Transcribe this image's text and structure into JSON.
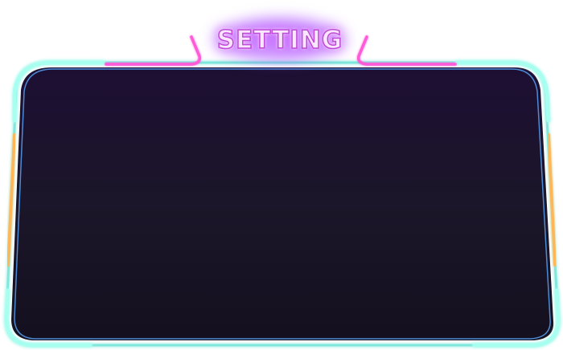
{
  "window": {
    "title": "SETTING"
  },
  "colors": {
    "panel_bg_top": "#1c1030",
    "panel_bg_bottom": "#12101e",
    "frame_cyan": "#7ff0e0",
    "frame_magenta": "#ff4fd8",
    "frame_orange": "#ffb347",
    "frame_blue": "#6ab8ff",
    "title_glow": "#b95cff"
  }
}
